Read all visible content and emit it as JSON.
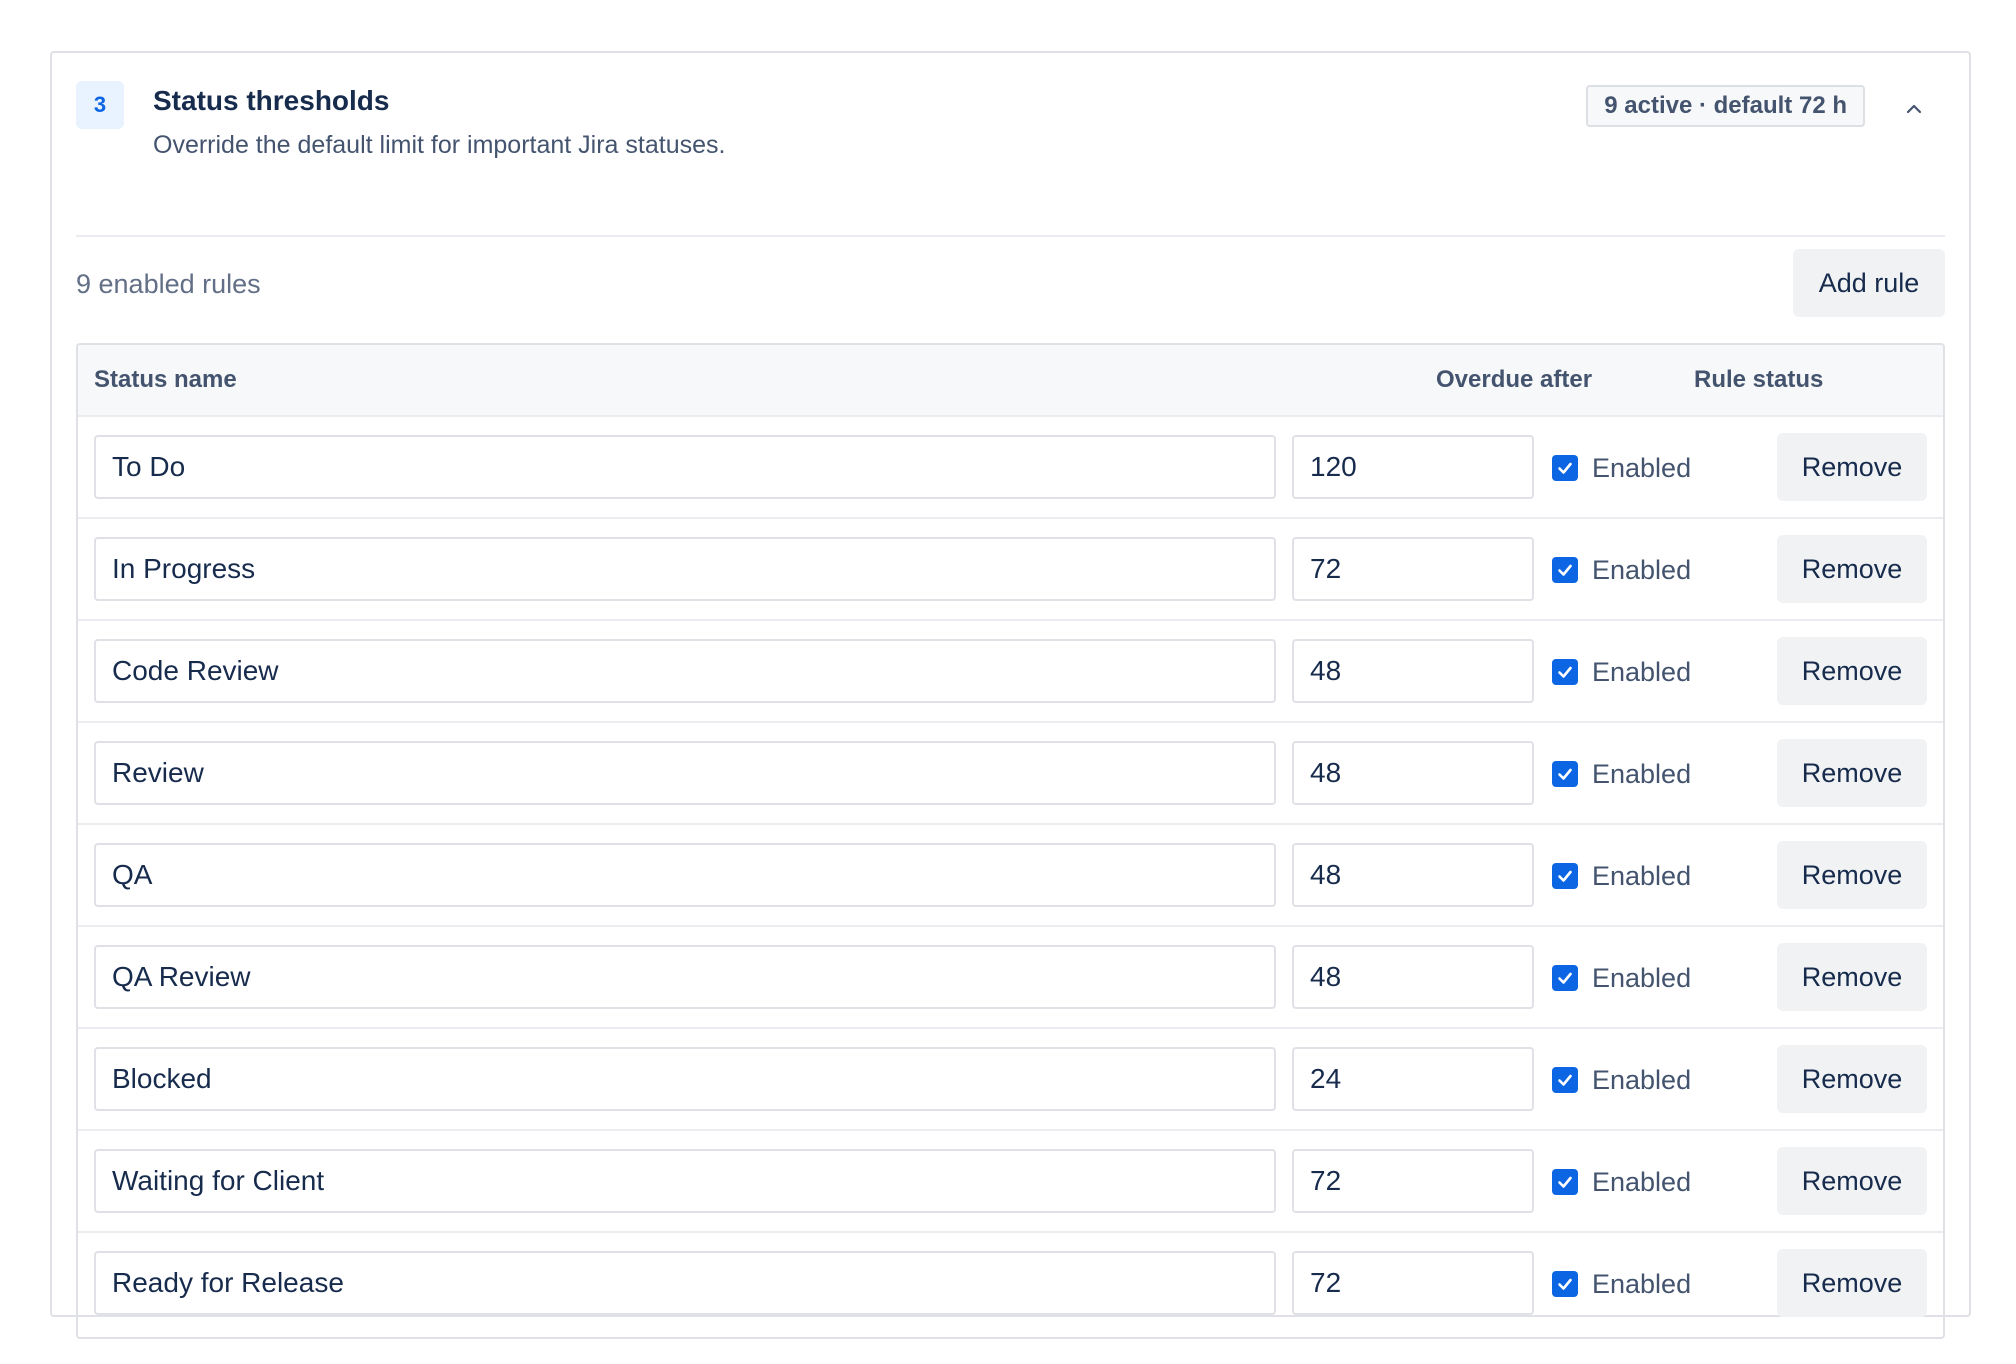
{
  "section": {
    "step": "3",
    "title": "Status thresholds",
    "description": "Override the default limit for important Jira statuses.",
    "summary": "9 active · default 72 h"
  },
  "toolbar": {
    "rules_count": "9 enabled rules",
    "add_rule_label": "Add rule"
  },
  "table": {
    "columns": {
      "status_name": "Status name",
      "overdue_after": "Overdue after",
      "rule_status": "Rule status"
    },
    "rows": [
      {
        "status": "To Do",
        "hours": "120",
        "enabled": true,
        "enabled_label": "Enabled",
        "remove_label": "Remove"
      },
      {
        "status": "In Progress",
        "hours": "72",
        "enabled": true,
        "enabled_label": "Enabled",
        "remove_label": "Remove"
      },
      {
        "status": "Code Review",
        "hours": "48",
        "enabled": true,
        "enabled_label": "Enabled",
        "remove_label": "Remove"
      },
      {
        "status": "Review",
        "hours": "48",
        "enabled": true,
        "enabled_label": "Enabled",
        "remove_label": "Remove"
      },
      {
        "status": "QA",
        "hours": "48",
        "enabled": true,
        "enabled_label": "Enabled",
        "remove_label": "Remove"
      },
      {
        "status": "QA Review",
        "hours": "48",
        "enabled": true,
        "enabled_label": "Enabled",
        "remove_label": "Remove"
      },
      {
        "status": "Blocked",
        "hours": "24",
        "enabled": true,
        "enabled_label": "Enabled",
        "remove_label": "Remove"
      },
      {
        "status": "Waiting for Client",
        "hours": "72",
        "enabled": true,
        "enabled_label": "Enabled",
        "remove_label": "Remove"
      },
      {
        "status": "Ready for Release",
        "hours": "72",
        "enabled": true,
        "enabled_label": "Enabled",
        "remove_label": "Remove"
      }
    ]
  },
  "icons": {
    "collapse": "chevron-up-icon",
    "checkbox": "checkmark-icon"
  },
  "colors": {
    "accent": "#0c66e4",
    "text": "#172b4d",
    "muted": "#44546f",
    "border": "#dfe1e6",
    "badge_bg": "#e9f2ff"
  }
}
